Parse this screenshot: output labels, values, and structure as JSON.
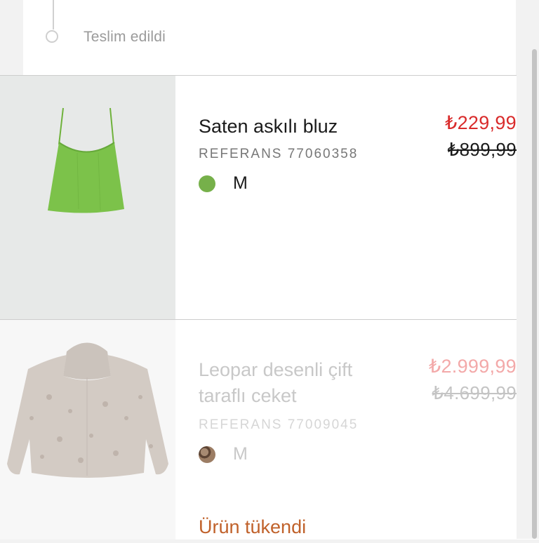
{
  "tracking": {
    "status_label": "Teslim edildi"
  },
  "products": [
    {
      "name": "Saten askılı bluz",
      "reference": "REFERANS 77060358",
      "color_hex": "#76b04a",
      "size": "M",
      "sale_price": "₺229,99",
      "original_price": "₺899,99"
    },
    {
      "name": "Leopar desenli çift taraflı ceket",
      "reference": "REFERANS 77009045",
      "color_hex": "#7a5c46",
      "size": "M",
      "sale_price": "₺2.999,99",
      "original_price": "₺4.699,99",
      "availability": "Ürün tükendi"
    }
  ],
  "colors": {
    "sale_red": "#d92b2b",
    "soldout_orange": "#c0612a"
  }
}
